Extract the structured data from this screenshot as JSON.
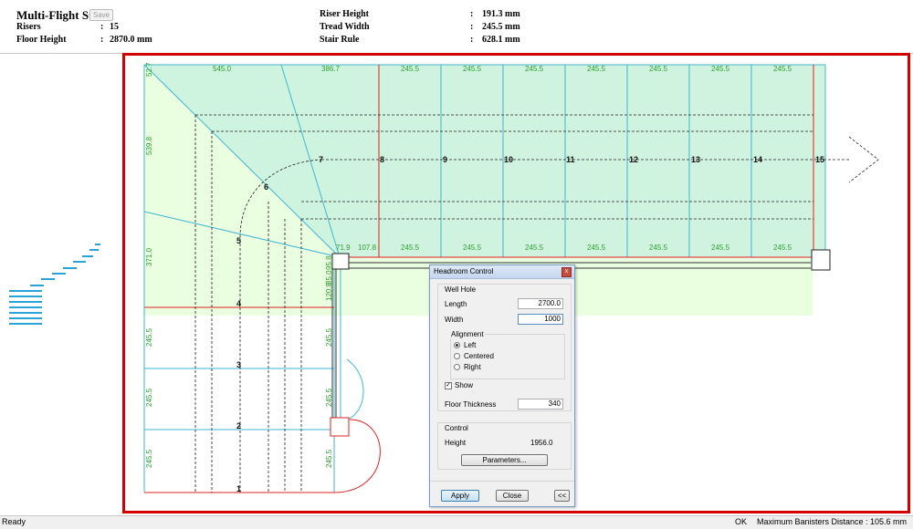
{
  "header": {
    "title": "Multi-Flight Stair",
    "save_label": "Save",
    "risers_label": "Risers",
    "risers_value": "15",
    "floor_height_label": "Floor Height",
    "floor_height_value": "2870.0 mm",
    "riser_height_label": "Riser Height",
    "riser_height_value": "191.3 mm",
    "tread_width_label": "Tread Width",
    "tread_width_value": "245.5 mm",
    "stair_rule_label": "Stair Rule",
    "stair_rule_value": "628.1 mm",
    "colon": ":"
  },
  "plan": {
    "top_dims": [
      "545.0",
      "386.7",
      "245.5",
      "245.5",
      "245.5",
      "245.5",
      "245.5",
      "245.5",
      "245.5"
    ],
    "inner_dims": [
      "71.9",
      "107.8",
      "245.5",
      "245.5",
      "245.5",
      "245.5",
      "245.5",
      "245.5",
      "245.5"
    ],
    "left_dims": [
      "52.7",
      "539.8",
      "371.0",
      "245.5",
      "245.5",
      "245.5"
    ],
    "inner_vert_dims": [
      "95.8",
      "85.0",
      "120.8",
      "245.5",
      "245.5",
      "245.5"
    ],
    "step_numbers": [
      "1",
      "2",
      "3",
      "4",
      "5",
      "6",
      "7",
      "8",
      "9",
      "10",
      "11",
      "12",
      "13",
      "14",
      "15"
    ]
  },
  "dialog": {
    "title": "Headroom Control",
    "close_glyph": "x",
    "well_hole_label": "Well Hole",
    "length_label": "Length",
    "length_value": "2700.0",
    "width_label": "Width",
    "width_value": "1000",
    "alignment_label": "Alignment",
    "align_options": [
      "Left",
      "Centered",
      "Right"
    ],
    "align_selected": "Left",
    "show_label": "Show",
    "show_checked": true,
    "floor_thickness_label": "Floor Thickness",
    "floor_thickness_value": "340",
    "control_label": "Control",
    "height_label": "Height",
    "height_value": "1956.0",
    "parameters_label": "Parameters...",
    "apply_label": "Apply",
    "close_label": "Close",
    "collapse_label": "<<"
  },
  "status": {
    "ready": "Ready",
    "ok": "OK",
    "banisters": "Maximum Banisters Distance : 105.6 mm"
  },
  "colors": {
    "frame_red": "#d40000",
    "landing_green": "#ccf5d8",
    "light_green": "#eaffe0",
    "dim_green": "#2ca02c",
    "edge_cyan": "#3fb6d6",
    "riser_red": "#e02020"
  }
}
